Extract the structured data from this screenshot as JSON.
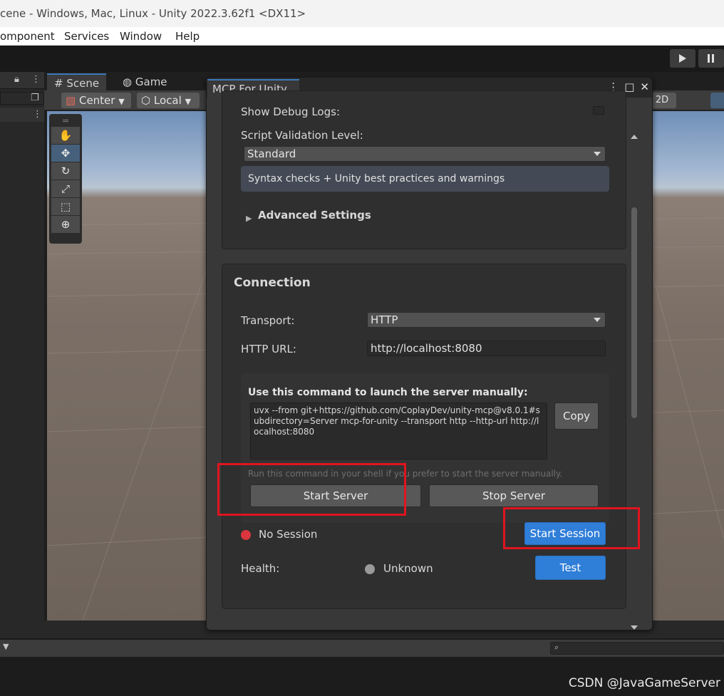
{
  "window": {
    "title": "cene - Windows, Mac, Linux - Unity 2022.3.62f1 <DX11>"
  },
  "menu": {
    "items": [
      "omponent",
      "Services",
      "Window",
      "Help"
    ]
  },
  "scene_view": {
    "tabs": [
      "Scene",
      "Game"
    ],
    "pivot": "Center",
    "space": "Local",
    "mode_2d": "2D"
  },
  "mcp_window": {
    "tab_title": "MCP For Unity",
    "debug_logs_label": "Show Debug Logs:",
    "script_validation_label": "Script Validation Level:",
    "script_validation_value": "Standard",
    "script_validation_info": "Syntax checks + Unity best practices and warnings",
    "advanced_settings": "Advanced Settings",
    "connection": {
      "heading": "Connection",
      "transport_label": "Transport:",
      "transport_value": "HTTP",
      "http_url_label": "HTTP URL:",
      "http_url_value": "http://localhost:8080",
      "manual_heading": "Use this command to launch the server manually:",
      "command": "uvx --from git+https://github.com/CoplayDev/unity-mcp@v8.0.1#subdirectory=Server mcp-for-unity --transport http --http-url http://localhost:8080",
      "copy_label": "Copy",
      "hint": "Run this command in your shell if you prefer to start the server manually.",
      "start_server_label": "Start Server",
      "stop_server_label": "Stop Server",
      "session_status": "No Session",
      "start_session_label": "Start Session",
      "health_label": "Health:",
      "health_value": "Unknown",
      "test_label": "Test"
    }
  },
  "watermark": "CSDN @JavaGameServer",
  "colors": {
    "accent_blue": "#2f7ed8",
    "session_red": "#d9363e",
    "annotation_red": "#e0141e",
    "health_gray": "#9a9a9a"
  }
}
